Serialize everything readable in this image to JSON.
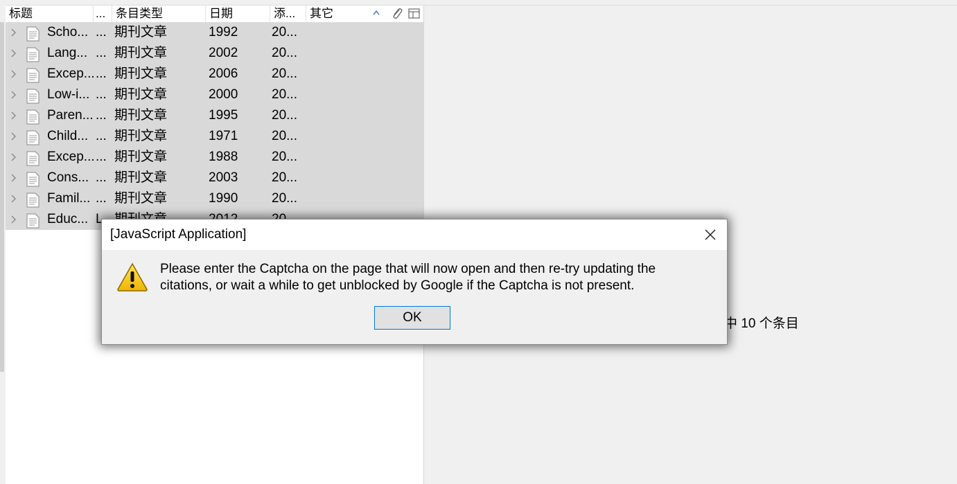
{
  "columns": {
    "title": "标题",
    "creator": "...",
    "item_type": "条目类型",
    "date": "日期",
    "date_added": "添...",
    "extra": "其它"
  },
  "rows": [
    {
      "title": "Scho...",
      "creator": "...",
      "type": "期刊文章",
      "date": "1992",
      "added": "20..."
    },
    {
      "title": "Lang...",
      "creator": "...",
      "type": "期刊文章",
      "date": "2002",
      "added": "20..."
    },
    {
      "title": "Excep...",
      "creator": "...",
      "type": "期刊文章",
      "date": "2006",
      "added": "20..."
    },
    {
      "title": "Low-i...",
      "creator": "...",
      "type": "期刊文章",
      "date": "2000",
      "added": "20..."
    },
    {
      "title": "Paren...",
      "creator": "...",
      "type": "期刊文章",
      "date": "1995",
      "added": "20..."
    },
    {
      "title": "Child...",
      "creator": "...",
      "type": "期刊文章",
      "date": "1971",
      "added": "20..."
    },
    {
      "title": "Excep...",
      "creator": "...",
      "type": "期刊文章",
      "date": "1988",
      "added": "20..."
    },
    {
      "title": "Cons...",
      "creator": "...",
      "type": "期刊文章",
      "date": "2003",
      "added": "20..."
    },
    {
      "title": "Famil...",
      "creator": "...",
      "type": "期刊文章",
      "date": "1990",
      "added": "20..."
    },
    {
      "title": "Educ...",
      "creator": "L...",
      "type": "期刊文章",
      "date": "2012",
      "added": "20..."
    }
  ],
  "item_pane": {
    "count_text": "中 10 个条目"
  },
  "dialog": {
    "title": "[JavaScript Application]",
    "message": "Please enter the Captcha on the page that will now open and then re-try updating the citations, or wait a while to get unblocked by Google if the Captcha is not present.",
    "ok_label": "OK",
    "icon": "warning-icon"
  },
  "colors": {
    "selected_row_bg": "#d9d9d9",
    "window_bg": "#f0f0f0",
    "accent_border": "#0078d7"
  }
}
